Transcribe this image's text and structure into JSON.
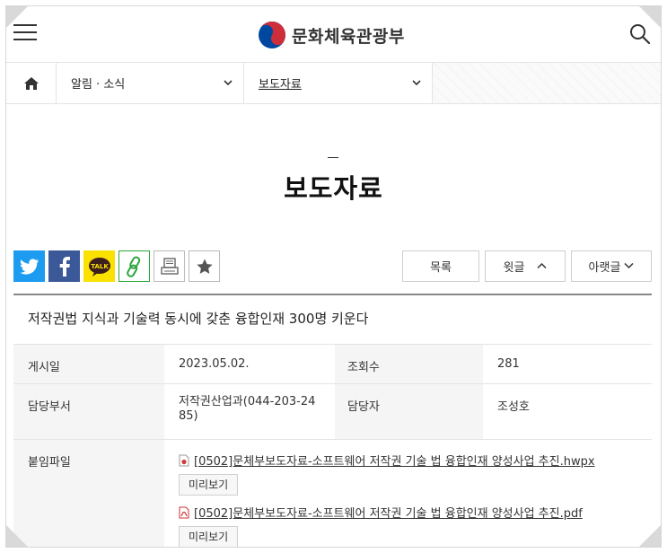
{
  "header": {
    "org_name": "문화체육관광부",
    "icons": {
      "menu": "hamburger-icon",
      "search": "search-icon",
      "logo": "taegeuk-emblem"
    }
  },
  "breadcrumb": {
    "home_icon": "home-icon",
    "level1": "알림 · 소식",
    "level2": "보도자료",
    "chevron": "⌄"
  },
  "page": {
    "title": "보도자료"
  },
  "share": {
    "icons": [
      "twitter-icon",
      "facebook-icon",
      "kakaotalk-icon",
      "link-icon",
      "print-icon",
      "favorite-star-icon"
    ],
    "kakao_label": "TALK"
  },
  "nav": {
    "list_label": "목록",
    "prev_label": "윗글",
    "next_label": "아랫글"
  },
  "article": {
    "title": "저작권법 지식과 기술력 동시에 갖춘 융합인재 300명 키운다",
    "fields": {
      "date_label": "게시일",
      "date_value": "2023.05.02.",
      "views_label": "조회수",
      "views_value": "281",
      "dept_label": "담당부서",
      "dept_value": "저작권산업과(044-203-2485)",
      "manager_label": "담당자",
      "manager_value": "조성호",
      "attach_label": "붙임파일"
    },
    "attachments": [
      {
        "name": "[0502]문체부보도자료-소프트웨어 저작권 기술 법 융합인재 양성사업 추진.hwpx",
        "type_icon": "hwp-file-icon",
        "preview_label": "미리보기"
      },
      {
        "name": "[0502]문체부보도자료-소프트웨어 저작권 기술 법 융합인재 양성사업 추진.pdf",
        "type_icon": "pdf-file-icon",
        "preview_label": "미리보기"
      }
    ]
  },
  "colors": {
    "twitter": "#1d9bf0",
    "facebook": "#3b5998",
    "kakao": "#fae100",
    "link_green": "#2aa63a",
    "emblem_red": "#cd2e3a",
    "emblem_blue": "#0047a0"
  }
}
